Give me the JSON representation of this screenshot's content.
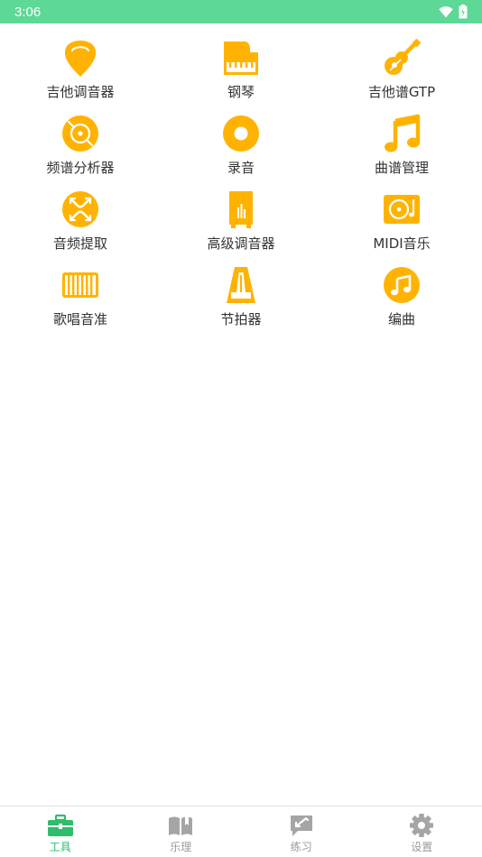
{
  "status_bar": {
    "time": "3:06"
  },
  "colors": {
    "status_bg": "#5dd896",
    "icon_accent": "#ffb300",
    "nav_active": "#2ebd6b",
    "nav_inactive": "#9a9a9a"
  },
  "tools": [
    {
      "label": "吉他调音器",
      "icon": "guitar-pick-icon"
    },
    {
      "label": "钢琴",
      "icon": "piano-icon"
    },
    {
      "label": "吉他谱GTP",
      "icon": "guitar-icon"
    },
    {
      "label": "频谱分析器",
      "icon": "spectrum-disc-icon"
    },
    {
      "label": "录音",
      "icon": "record-icon"
    },
    {
      "label": "曲谱管理",
      "icon": "music-note-icon"
    },
    {
      "label": "音频提取",
      "icon": "audio-extract-icon"
    },
    {
      "label": "高级调音器",
      "icon": "advanced-tuner-icon"
    },
    {
      "label": "MIDI音乐",
      "icon": "midi-player-icon"
    },
    {
      "label": "歌唱音准",
      "icon": "keyboard-icon"
    },
    {
      "label": "节拍器",
      "icon": "metronome-icon"
    },
    {
      "label": "编曲",
      "icon": "compose-note-icon"
    }
  ],
  "bottom_nav": [
    {
      "label": "工具",
      "icon": "toolbox-icon",
      "active": true
    },
    {
      "label": "乐理",
      "icon": "book-icon",
      "active": false
    },
    {
      "label": "练习",
      "icon": "practice-icon",
      "active": false
    },
    {
      "label": "设置",
      "icon": "gear-icon",
      "active": false
    }
  ]
}
